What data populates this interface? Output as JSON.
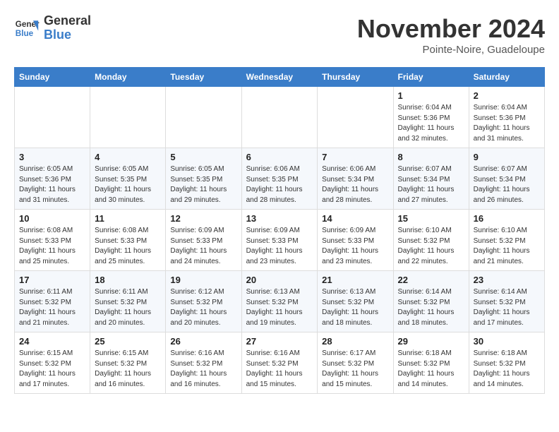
{
  "header": {
    "logo_general": "General",
    "logo_blue": "Blue",
    "month": "November 2024",
    "location": "Pointe-Noire, Guadeloupe"
  },
  "weekdays": [
    "Sunday",
    "Monday",
    "Tuesday",
    "Wednesday",
    "Thursday",
    "Friday",
    "Saturday"
  ],
  "weeks": [
    [
      {
        "day": "",
        "info": ""
      },
      {
        "day": "",
        "info": ""
      },
      {
        "day": "",
        "info": ""
      },
      {
        "day": "",
        "info": ""
      },
      {
        "day": "",
        "info": ""
      },
      {
        "day": "1",
        "info": "Sunrise: 6:04 AM\nSunset: 5:36 PM\nDaylight: 11 hours and 32 minutes."
      },
      {
        "day": "2",
        "info": "Sunrise: 6:04 AM\nSunset: 5:36 PM\nDaylight: 11 hours and 31 minutes."
      }
    ],
    [
      {
        "day": "3",
        "info": "Sunrise: 6:05 AM\nSunset: 5:36 PM\nDaylight: 11 hours and 31 minutes."
      },
      {
        "day": "4",
        "info": "Sunrise: 6:05 AM\nSunset: 5:35 PM\nDaylight: 11 hours and 30 minutes."
      },
      {
        "day": "5",
        "info": "Sunrise: 6:05 AM\nSunset: 5:35 PM\nDaylight: 11 hours and 29 minutes."
      },
      {
        "day": "6",
        "info": "Sunrise: 6:06 AM\nSunset: 5:35 PM\nDaylight: 11 hours and 28 minutes."
      },
      {
        "day": "7",
        "info": "Sunrise: 6:06 AM\nSunset: 5:34 PM\nDaylight: 11 hours and 28 minutes."
      },
      {
        "day": "8",
        "info": "Sunrise: 6:07 AM\nSunset: 5:34 PM\nDaylight: 11 hours and 27 minutes."
      },
      {
        "day": "9",
        "info": "Sunrise: 6:07 AM\nSunset: 5:34 PM\nDaylight: 11 hours and 26 minutes."
      }
    ],
    [
      {
        "day": "10",
        "info": "Sunrise: 6:08 AM\nSunset: 5:33 PM\nDaylight: 11 hours and 25 minutes."
      },
      {
        "day": "11",
        "info": "Sunrise: 6:08 AM\nSunset: 5:33 PM\nDaylight: 11 hours and 25 minutes."
      },
      {
        "day": "12",
        "info": "Sunrise: 6:09 AM\nSunset: 5:33 PM\nDaylight: 11 hours and 24 minutes."
      },
      {
        "day": "13",
        "info": "Sunrise: 6:09 AM\nSunset: 5:33 PM\nDaylight: 11 hours and 23 minutes."
      },
      {
        "day": "14",
        "info": "Sunrise: 6:09 AM\nSunset: 5:33 PM\nDaylight: 11 hours and 23 minutes."
      },
      {
        "day": "15",
        "info": "Sunrise: 6:10 AM\nSunset: 5:32 PM\nDaylight: 11 hours and 22 minutes."
      },
      {
        "day": "16",
        "info": "Sunrise: 6:10 AM\nSunset: 5:32 PM\nDaylight: 11 hours and 21 minutes."
      }
    ],
    [
      {
        "day": "17",
        "info": "Sunrise: 6:11 AM\nSunset: 5:32 PM\nDaylight: 11 hours and 21 minutes."
      },
      {
        "day": "18",
        "info": "Sunrise: 6:11 AM\nSunset: 5:32 PM\nDaylight: 11 hours and 20 minutes."
      },
      {
        "day": "19",
        "info": "Sunrise: 6:12 AM\nSunset: 5:32 PM\nDaylight: 11 hours and 20 minutes."
      },
      {
        "day": "20",
        "info": "Sunrise: 6:13 AM\nSunset: 5:32 PM\nDaylight: 11 hours and 19 minutes."
      },
      {
        "day": "21",
        "info": "Sunrise: 6:13 AM\nSunset: 5:32 PM\nDaylight: 11 hours and 18 minutes."
      },
      {
        "day": "22",
        "info": "Sunrise: 6:14 AM\nSunset: 5:32 PM\nDaylight: 11 hours and 18 minutes."
      },
      {
        "day": "23",
        "info": "Sunrise: 6:14 AM\nSunset: 5:32 PM\nDaylight: 11 hours and 17 minutes."
      }
    ],
    [
      {
        "day": "24",
        "info": "Sunrise: 6:15 AM\nSunset: 5:32 PM\nDaylight: 11 hours and 17 minutes."
      },
      {
        "day": "25",
        "info": "Sunrise: 6:15 AM\nSunset: 5:32 PM\nDaylight: 11 hours and 16 minutes."
      },
      {
        "day": "26",
        "info": "Sunrise: 6:16 AM\nSunset: 5:32 PM\nDaylight: 11 hours and 16 minutes."
      },
      {
        "day": "27",
        "info": "Sunrise: 6:16 AM\nSunset: 5:32 PM\nDaylight: 11 hours and 15 minutes."
      },
      {
        "day": "28",
        "info": "Sunrise: 6:17 AM\nSunset: 5:32 PM\nDaylight: 11 hours and 15 minutes."
      },
      {
        "day": "29",
        "info": "Sunrise: 6:18 AM\nSunset: 5:32 PM\nDaylight: 11 hours and 14 minutes."
      },
      {
        "day": "30",
        "info": "Sunrise: 6:18 AM\nSunset: 5:32 PM\nDaylight: 11 hours and 14 minutes."
      }
    ]
  ]
}
